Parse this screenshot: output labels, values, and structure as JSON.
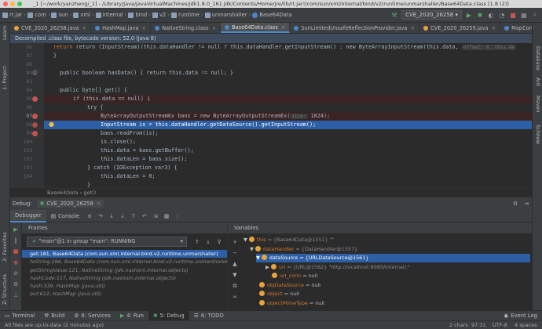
{
  "window": {
    "title": "_1 [~/work/yanzheng/_1] - /Library/Java/JavaVirtualMachines/jdk1.8.0_161.jdk/Contents/Home/jre/lib/rt.jar!/com/sun/xml/internal/bind/v2/runtime/unmarshaller/Base64Data.class [1.8 (2)]"
  },
  "navbar": {
    "items": [
      "rt.jar",
      "com",
      "sun",
      "xml",
      "internal",
      "bind",
      "v2",
      "runtime",
      "unmarshaller",
      "Base64Data"
    ],
    "run_config": "CVE_2020_26258"
  },
  "left_strip": {
    "project": "1: Project",
    "learn": "Learn",
    "structure": "Z: Structure",
    "favorites": "2: Favorites"
  },
  "right_strip": {
    "database": "Database",
    "ant": "Ant",
    "maven": "Maven",
    "sciview": "SciView"
  },
  "tabs": [
    {
      "label": "CVE_2020_26258.java"
    },
    {
      "label": "HashMap.java"
    },
    {
      "label": "NativeString.class"
    },
    {
      "label": "Base64Data.class"
    },
    {
      "label": "SunLimitedUnsafeReflectionProvider.java"
    },
    {
      "label": "CVE_2020_26259.java"
    },
    {
      "label": "MapConverter.ja"
    }
  ],
  "banner": "Decompiled .class file, bytecode version: 52.0 (Java 8)",
  "code": {
    "line_numbers": [
      "86",
      "87",
      "88",
      "89",
      "90",
      "91",
      "92",
      "93",
      "94",
      "95",
      "96",
      "97",
      "98",
      "99",
      "100",
      "101",
      "102",
      "103",
      "104",
      "105",
      "106"
    ],
    "l86": "return (InputStream)(this.dataHandler != null ? this.dataHandler.getInputStream() : new ByteArrayInputStream(this.data,",
    "l86_hint": "offset: 0, this.da",
    "l89_a": "public boolean hasData() { return this.data != null; }",
    "l93": "public byte[] get() {",
    "l94": "if (this.data == null) {",
    "l95": "try {",
    "l96": "ByteArrayOutputStreamEx baos = new ByteArrayOutputStreamEx(",
    "l96_hint": "size:",
    "l96_b": "1024);",
    "l97": "InputStream is = this.dataHandler.getDataSource().getInputStream();",
    "l98": "baos.readFrom(is);",
    "l99": "is.close();",
    "l100": "this.data = baos.getBuffer();",
    "l101": "this.dataLen = baos.size();",
    "l102": "} catch (IOException var3) {",
    "l103": "this.dataLen = 0;",
    "l104": "}"
  },
  "editor_crumb": {
    "class": "Base64Data",
    "method": "get()"
  },
  "debug": {
    "label": "Debug:",
    "session": "CVE_2020_26258",
    "tabs": {
      "debugger": "Debugger",
      "console": "Console"
    },
    "frames_header": "Frames",
    "variables_header": "Variables",
    "thread": "\"main\"@1 in group \"main\": RUNNING",
    "frames": [
      "get:181, Base64Data (com.sun.xml.internal.bind.v2.runtime.unmarshaller)",
      "toString:286, Base64Data (com.sun.xml.internal.bind.v2.runtime.unmarshaller)",
      "getStringValue:121, NativeString (jdk.nashorn.internal.objects)",
      "hashCode:117, NativeString (jdk.nashorn.internal.objects)",
      "hash:339, HashMap (java.util)",
      "put:612, HashMap (java.util)"
    ],
    "variables": [
      {
        "name": "this",
        "value": "= {Base64Data@1551} \"\""
      },
      {
        "name": "dataHandler",
        "value": "= {DataHandler@1557}"
      },
      {
        "name": "dataSource",
        "value": "= {URLDataSource@1561}"
      },
      {
        "name": "url",
        "value": "= {URL@1562} \"http://localhost:8989/internal/:\""
      },
      {
        "name": "url_conn",
        "value": "= null"
      },
      {
        "name": "objDataSource",
        "value": "= null"
      },
      {
        "name": "object",
        "value": "= null"
      },
      {
        "name": "objectMimeType",
        "value": "= null"
      }
    ]
  },
  "bottom_tabs": {
    "terminal": "Terminal",
    "build": "Build",
    "services": "8: Services",
    "run": "4: Run",
    "debug": "5: Debug",
    "todo": "6: TODO",
    "event_log": "Event Log"
  },
  "status": {
    "message": "All files are up-to-date (2 minutes ago)",
    "chars": "2 chars",
    "position": "97:31",
    "encoding": "UTF-8",
    "indent": "4 spaces"
  },
  "colors": {
    "accent": "#4a88c7",
    "breakpoint": "#c75450",
    "selection": "#2d5fa6"
  }
}
